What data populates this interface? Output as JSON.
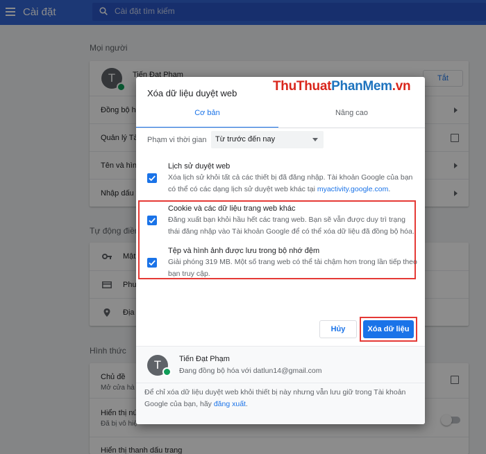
{
  "topbar": {
    "title": "Cài đặt",
    "search_placeholder": "Cài đặt tìm kiếm"
  },
  "people": {
    "heading": "Mọi người",
    "profile_name": "Tiến Đạt Phạm",
    "profile_initial": "T",
    "signout_label": "Tắt",
    "rows": [
      "Đồng bộ hó",
      "Quản lý Tài",
      "Tên và hình",
      "Nhập dấu t"
    ]
  },
  "autofill": {
    "heading": "Tự động điền",
    "rows": [
      "Mật",
      "Phư",
      "Địa"
    ]
  },
  "appearance": {
    "heading": "Hình thức",
    "theme_label": "Chủ đề",
    "theme_sub": "Mở cửa hà",
    "home_label": "Hiển thị nú",
    "home_sub": "Đã bị vô hiệ",
    "bookmarks_label": "Hiển thị thanh dấu trang"
  },
  "dialog": {
    "title": "Xóa dữ liệu duyệt web",
    "watermark_a": "ThuThuat",
    "watermark_b": "PhanMem",
    "watermark_c": ".vn",
    "tab_basic": "Cơ bản",
    "tab_advanced": "Nâng cao",
    "time_range_label": "Phạm vi thời gian",
    "time_range_value": "Từ trước đến nay",
    "options": [
      {
        "title": "Lịch sử duyệt web",
        "desc": "Xóa lịch sử khỏi tất cả các thiết bị đã đăng nhập. Tài khoản Google của bạn có thể có các dạng lịch sử duyệt web khác tại ",
        "link": "myactivity.google.com",
        "tail": ".",
        "checked": true
      },
      {
        "title": "Cookie và các dữ liệu trang web khác",
        "desc": "Đăng xuất bạn khỏi hầu hết các trang web. Bạn sẽ vẫn được duy trì trạng thái đăng nhập vào Tài khoản Google để có thể xóa dữ liệu đã đồng bộ hóa.",
        "checked": true
      },
      {
        "title": "Tệp và hình ảnh được lưu trong bộ nhớ đệm",
        "desc": "Giải phóng 319 MB. Một số trang web có thể tải chậm hơn trong lần tiếp theo bạn truy cập.",
        "checked": true
      }
    ],
    "cancel_label": "Hủy",
    "clear_label": "Xóa dữ liệu",
    "footer_initial": "T",
    "footer_name": "Tiến Đạt Phạm",
    "footer_sync": "Đang đồng bộ hóa với datlun14@gmail.com",
    "footer_note": "Để chỉ xóa dữ liệu duyệt web khỏi thiết bị này nhưng vẫn lưu giữ trong Tài khoản Google của bạn, hãy ",
    "footer_link": "đăng xuất",
    "footer_tail": "."
  },
  "colors": {
    "topbar": "#3367d6",
    "accent": "#1a73e8",
    "highlight": "#e53935",
    "sync": "#0f9d58"
  }
}
